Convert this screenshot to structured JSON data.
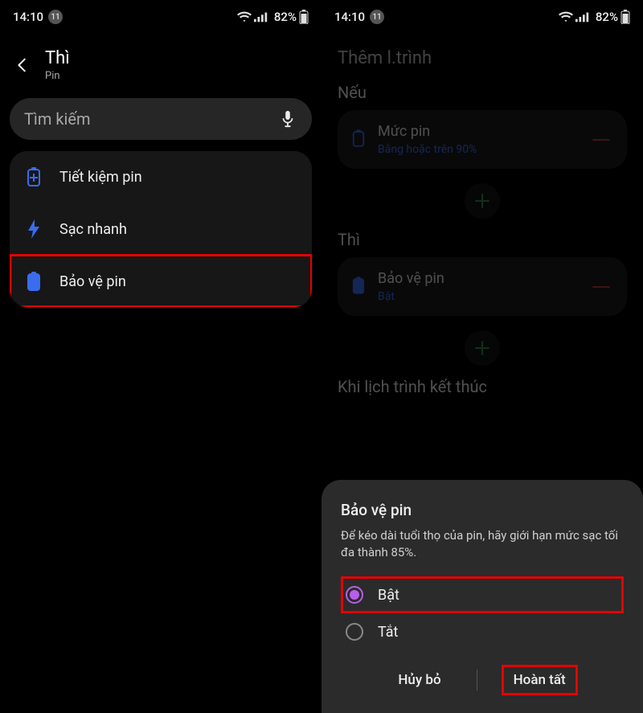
{
  "statusbar": {
    "time": "14:10",
    "notif_count": "11",
    "battery_pct": "82%"
  },
  "left": {
    "header": {
      "title": "Thì",
      "subtitle": "Pin"
    },
    "search_placeholder": "Tìm kiếm",
    "items": [
      {
        "icon": "battery-saver-icon",
        "label": "Tiết kiệm pin"
      },
      {
        "icon": "bolt-icon",
        "label": "Sạc nhanh"
      },
      {
        "icon": "battery-protect-icon",
        "label": "Bảo vệ pin"
      }
    ]
  },
  "right": {
    "heading": "Thêm l.trình",
    "section_if": "Nếu",
    "if_card": {
      "label": "Mức pin",
      "sub": "Bằng hoặc trên 90%"
    },
    "section_then": "Thì",
    "then_card": {
      "label": "Bảo vệ pin",
      "sub": "Bật"
    },
    "section_end": "Khi lịch trình kết thúc"
  },
  "sheet": {
    "title": "Bảo vệ pin",
    "desc": "Để kéo dài tuổi thọ của pin, hãy giới hạn mức sạc tối đa thành 85%.",
    "opt_on": "Bật",
    "opt_off": "Tắt",
    "cancel": "Hủy bỏ",
    "done": "Hoàn tất"
  }
}
